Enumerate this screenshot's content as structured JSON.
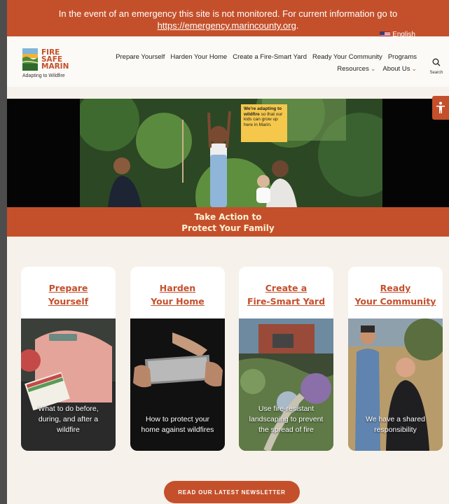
{
  "banner": {
    "text": "In the event of an emergency this site is not monitored. For current information go to",
    "link": "https://emergency.marincounty.org",
    "suffix": "."
  },
  "language": {
    "label": "English",
    "icon": "us-flag-icon"
  },
  "logo": {
    "line1": "FIRE",
    "line2": "SAFE",
    "line3": "MARIN",
    "tagline": "Adapting to Wildfire"
  },
  "nav": {
    "row1": [
      "Prepare Yourself",
      "Harden Your Home",
      "Create a Fire-Smart Yard",
      "Ready Your Community",
      "Programs"
    ],
    "resources": "Resources",
    "about": "About Us",
    "search_label": "Search"
  },
  "hero": {
    "badge_bold": "We're adapting to wildfire",
    "badge_text": "so that our kids can grow up here in Marin."
  },
  "cta": {
    "line1": "Take Action to",
    "line2": "Protect Your Family"
  },
  "cards": [
    {
      "title1": "Prepare",
      "title2": "Yourself",
      "caption": "What to do before, during, and after a wildfire",
      "note": "WILDFIRE EVACUATION CHECKLIST"
    },
    {
      "title1": "Harden",
      "title2": "Your Home",
      "caption": "How to protect your home against wildfires"
    },
    {
      "title1": "Create a",
      "title2": "Fire-Smart Yard",
      "caption": "Use fire-resistant landscaping to prevent the spread of fire"
    },
    {
      "title1": "Ready",
      "title2": "Your Community",
      "caption": "We have a shared responsibility"
    }
  ],
  "newsletter": {
    "label": "READ OUR LATEST NEWSLETTER"
  },
  "colors": {
    "brand": "#c4502b",
    "cream": "#f6f1ea",
    "badge": "#f5c84c"
  }
}
